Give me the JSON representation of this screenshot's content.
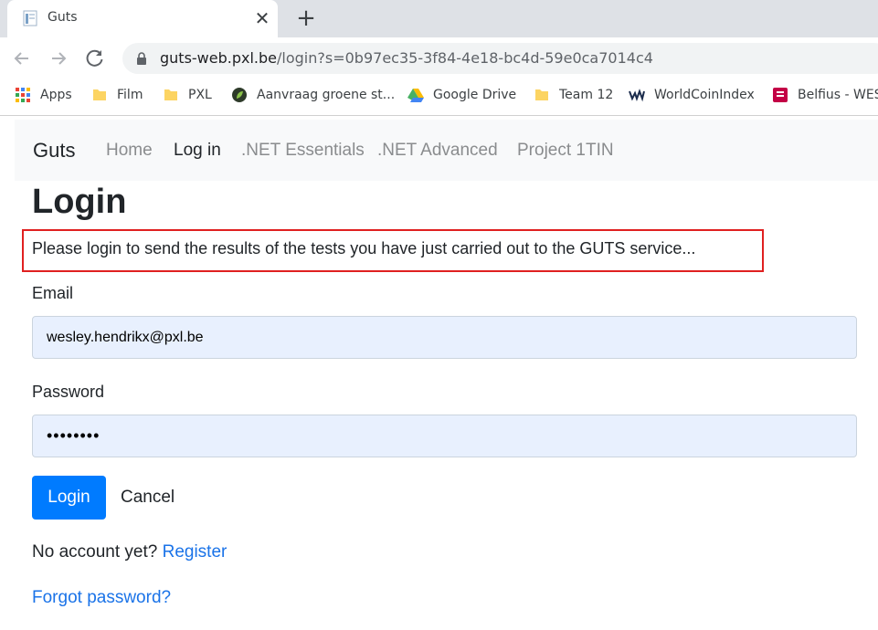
{
  "browser": {
    "tab_title": "Guts",
    "tab_close": "✕",
    "new_tab": "+",
    "url_host": "guts-web.pxl.be",
    "url_path": "/login?s=0b97ec35-3f84-4e18-bc4d-59e0ca7014c4",
    "bookmarks": [
      {
        "label": "Apps",
        "icon": "apps-grid-icon"
      },
      {
        "label": "Film",
        "icon": "folder-icon"
      },
      {
        "label": "PXL",
        "icon": "folder-icon"
      },
      {
        "label": "Aanvraag groene st...",
        "icon": "leaf-icon"
      },
      {
        "label": "Google Drive",
        "icon": "google-drive-icon"
      },
      {
        "label": "Team 12",
        "icon": "folder-icon"
      },
      {
        "label": "WorldCoinIndex",
        "icon": "worldcoinindex-icon"
      },
      {
        "label": "Belfius - WES",
        "icon": "belfius-icon"
      }
    ]
  },
  "navbar": {
    "brand": "Guts",
    "links": [
      {
        "label": "Home",
        "active": false
      },
      {
        "label": "Log in",
        "active": true
      },
      {
        "label": ".NET Essentials",
        "active": false
      },
      {
        "label": ".NET Advanced",
        "active": false
      },
      {
        "label": "Project 1TIN",
        "active": false
      }
    ]
  },
  "page": {
    "title": "Login",
    "intro": "Please login to send the results of the tests you have just carried out to the GUTS service...",
    "email_label": "Email",
    "email_value": "wesley.hendrikx@pxl.be",
    "password_label": "Password",
    "password_value": "••••••••",
    "login_button": "Login",
    "cancel_link": "Cancel",
    "no_account_text": "No account yet?",
    "register_link": "Register",
    "forgot_link": "Forgot password?"
  },
  "colors": {
    "primary": "#007bff",
    "link": "#1a73e8",
    "highlight_border": "#e02020",
    "autofill_bg": "#e8f0fe"
  }
}
